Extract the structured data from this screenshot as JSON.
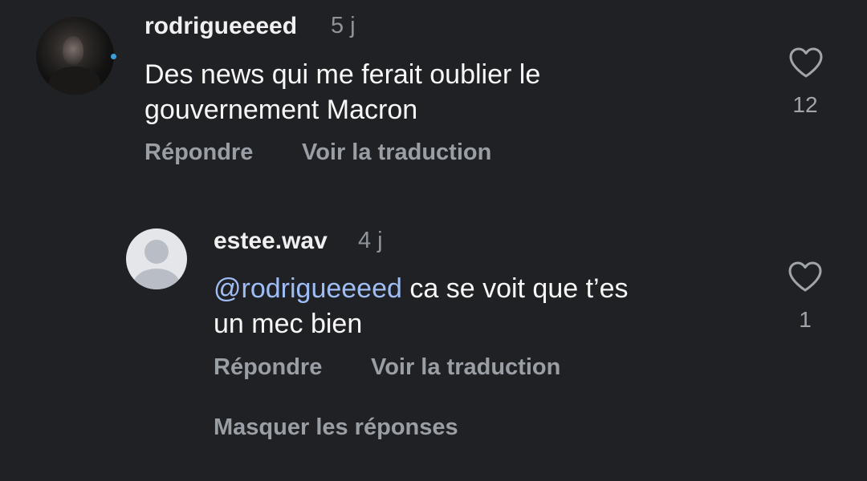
{
  "comments": [
    {
      "username": "rodrigueeeed",
      "time": "5 j",
      "text_line1": "Des news qui me ferait oublier le",
      "text_line2": "gouvernement Macron",
      "reply_label": "Répondre",
      "translate_label": "Voir la traduction",
      "like_count": "12",
      "like_icon": "heart-outline-icon",
      "avatar": "profile-photo",
      "story_dot_color": "#3b9fd8"
    }
  ],
  "replies": [
    {
      "username": "estee.wav",
      "time": "4 j",
      "mention": "@rodrigueeeed",
      "text_line1_rest": " ca se voit que t’es",
      "text_line2": "un mec bien",
      "reply_label": "Répondre",
      "translate_label": "Voir la traduction",
      "like_count": "1",
      "like_icon": "heart-outline-icon",
      "avatar": "default-avatar"
    }
  ],
  "hide_replies_label": "Masquer les réponses",
  "colors": {
    "background": "#202124",
    "text": "#f7f7f7",
    "muted": "#9a9ea5",
    "mention": "#9fbdf5"
  }
}
